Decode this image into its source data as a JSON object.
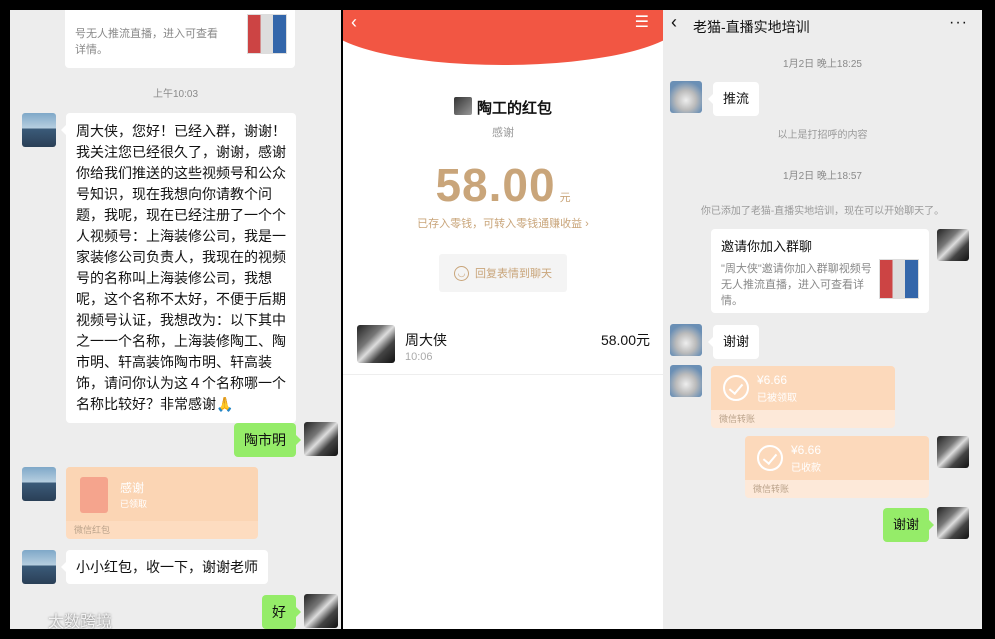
{
  "panel1": {
    "top_card_desc": "号无人推流直播，进入可查看\n详情。",
    "time": "上午10:03",
    "msg_long": "周大侠，您好！已经入群，谢谢！我关注您已经很久了，谢谢，感谢你给我们推送的这些视频号和公众号知识，现在我想向你请教个问题，我呢，现在已经注册了一个个人视频号：上海装修公司，我是一家装修公司负责人，我现在的视频号的名称叫上海装修公司，我想呢，这个名称不太好，不便于后期视频号认证，我想改为：以下其中之一一个名称，上海装修陶工、陶市明、轩高装饰陶市明、轩高装饰，请问你认为这４个名称哪一个名称比较好？非常感谢🙏",
    "reply_name": "陶市明",
    "redpacket_title": "感谢",
    "redpacket_state": "已领取",
    "redpacket_foot": "微信红包",
    "msg_small": "小小红包，收一下，谢谢老师",
    "reply_ok": "好"
  },
  "panel2": {
    "sender_title": "陶工的红包",
    "subtitle": "感谢",
    "amount": "58.00",
    "unit": "元",
    "stored_note": "已存入零钱，可转入零钱通赚收益",
    "reply_sticker": "回复表情到聊天",
    "receiver_name": "周大侠",
    "receiver_time": "10:06",
    "receiver_amount": "58.00元"
  },
  "panel3": {
    "title": "老猫-直播实地培训",
    "more": "···",
    "time1": "1月2日 晚上18:25",
    "msg_tuiliu": "推流",
    "greeting_note": "以上是打招呼的内容",
    "time2": "1月2日 晚上18:57",
    "added_note": "你已添加了老猫-直播实地培训，现在可以开始聊天了。",
    "invite_title": "邀请你加入群聊",
    "invite_desc": "\"周大侠\"邀请你加入群聊视频号无人推流直播，进入可查看详情。",
    "msg_thanks": "谢谢",
    "transfer1_amount": "¥6.66",
    "transfer1_state": "已被领取",
    "transfer_foot": "微信转账",
    "transfer2_amount": "¥6.66",
    "transfer2_state": "已收款",
    "msg_thanks2": "谢谢"
  },
  "watermark": "太数跨境"
}
